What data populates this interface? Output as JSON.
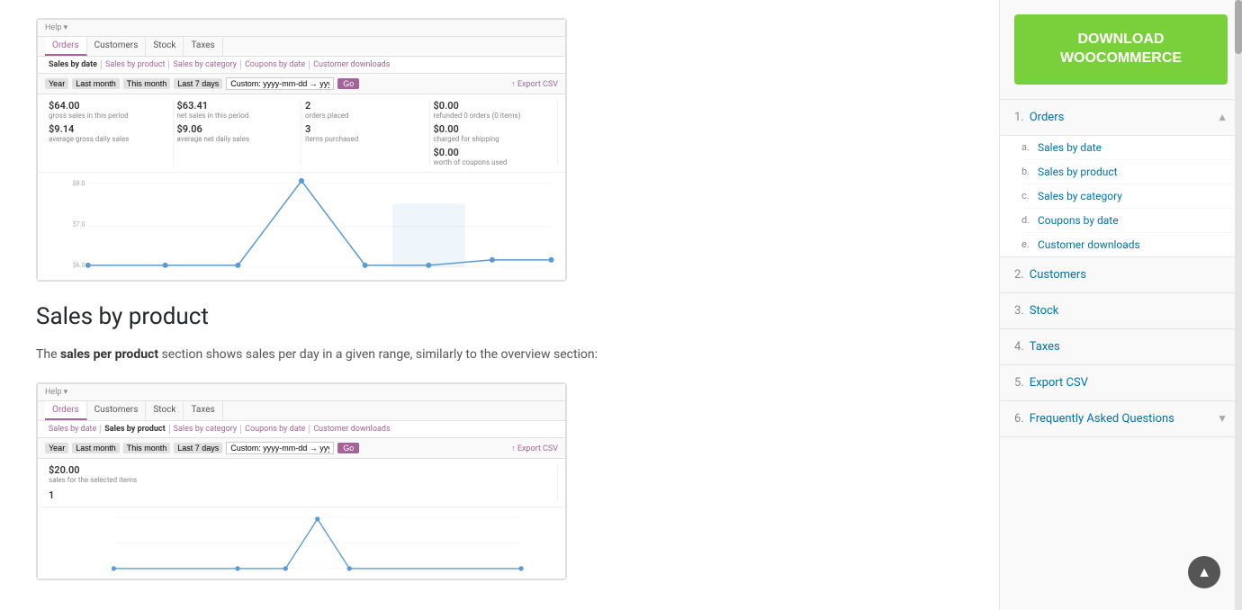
{
  "main": {
    "screenshot1": {
      "nav_tabs": [
        "Orders",
        "Customers",
        "Stock",
        "Taxes"
      ],
      "active_tab": "Orders",
      "sub_tabs": [
        "Sales by date",
        "Sales by product",
        "Sales by category",
        "Coupons by date",
        "Customer downloads"
      ],
      "active_sub_tab": "Sales by date",
      "date_buttons": [
        "Year",
        "Last month",
        "This month",
        "Last 7 days"
      ],
      "date_placeholder": "Custom: yyyy-mm-dd → yyyy-mm-dd",
      "go_label": "Go",
      "export_label": "↑ Export CSV",
      "help_label": "Help ▾",
      "stats": [
        {
          "value": "$64.00",
          "label": "gross sales in this period"
        },
        {
          "value": "$9.14",
          "label": "average gross daily sales"
        },
        {
          "value": "$63.41",
          "label": "net sales in this period"
        },
        {
          "value": "$9.06",
          "label": "average net daily sales"
        },
        {
          "value": "2",
          "label": "orders placed"
        },
        {
          "value": "3",
          "label": "items purchased"
        },
        {
          "value": "$0.00",
          "label": "refunded 0 orders (0 items)"
        },
        {
          "value": "$0.00",
          "label": "charged for shipping"
        },
        {
          "value": "$0.00",
          "label": "worth of coupons used"
        }
      ]
    },
    "section_heading": "Sales by product",
    "section_text_prefix": "The ",
    "section_text_bold": "sales per product",
    "section_text_suffix": " section shows sales per day in a given range, similarly to the overview section:",
    "screenshot2": {
      "nav_tabs": [
        "Orders",
        "Customers",
        "Stock",
        "Taxes"
      ],
      "active_tab": "Orders",
      "sub_tabs": [
        "Sales by date",
        "Sales by product",
        "Sales by category",
        "Coupons by date",
        "Customer downloads"
      ],
      "active_sub_tab": "Sales by product",
      "date_buttons": [
        "Year",
        "Last month",
        "This month",
        "Last 7 days"
      ],
      "date_placeholder": "Custom: yyyy-mm-dd → yyyy-mm-dd",
      "go_label": "Go",
      "export_label": "↑ Export CSV",
      "stats": [
        {
          "value": "$20.00",
          "label": "sales for the selected items"
        },
        {
          "value": "1",
          "label": ""
        }
      ]
    }
  },
  "sidebar": {
    "download_btn_line1": "DOWNLOAD",
    "download_btn_line2": "WOOCOMMERCE",
    "toc": [
      {
        "number": "1.",
        "label": "Orders",
        "active": true,
        "expanded": true,
        "sub_items": [
          {
            "letter": "a.",
            "label": "Sales by date"
          },
          {
            "letter": "b.",
            "label": "Sales by product"
          },
          {
            "letter": "c.",
            "label": "Sales by category"
          },
          {
            "letter": "d.",
            "label": "Coupons by date"
          },
          {
            "letter": "e.",
            "label": "Customer downloads"
          }
        ]
      },
      {
        "number": "2.",
        "label": "Customers",
        "active": false,
        "expanded": false
      },
      {
        "number": "3.",
        "label": "Stock",
        "active": false,
        "expanded": false
      },
      {
        "number": "4.",
        "label": "Taxes",
        "active": false,
        "expanded": false
      },
      {
        "number": "5.",
        "label": "Export CSV",
        "active": false,
        "expanded": false
      },
      {
        "number": "6.",
        "label": "Frequently Asked Questions",
        "active": false,
        "expanded": false,
        "has_chevron": true
      }
    ]
  },
  "scroll_top": "▲",
  "colors": {
    "green_btn": "#7ad03a",
    "link_color": "#0073aa",
    "orders_open": "#a46497"
  }
}
